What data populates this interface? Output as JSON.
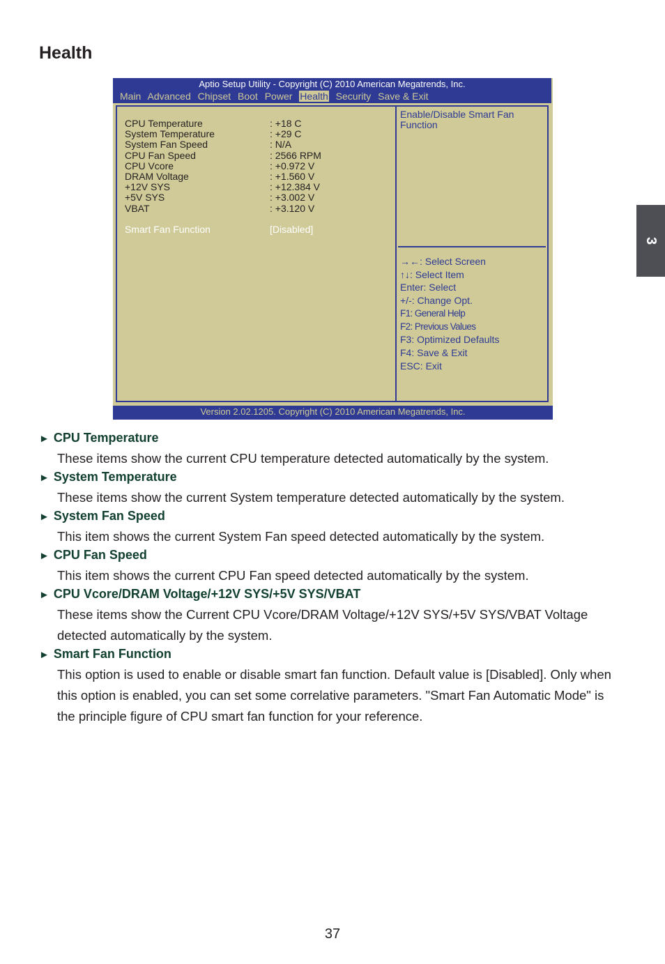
{
  "page": {
    "title": "Health",
    "chapter_tab": "3",
    "page_number": "37"
  },
  "bios": {
    "title": "Aptio Setup Utility - Copyright (C) 2010 American Megatrends, Inc.",
    "menu": [
      "Main",
      "Advanced",
      "Chipset",
      "Boot",
      "Power",
      "Health",
      "Security",
      "Save & Exit"
    ],
    "active_menu": "Health",
    "rows": [
      {
        "label": "CPU Temperature",
        "value": ": +18 C"
      },
      {
        "label": "System Temperature",
        "value": ": +29 C"
      },
      {
        "label": "System Fan Speed",
        "value": ": N/A"
      },
      {
        "label": "CPU Fan Speed",
        "value": ": 2566 RPM"
      },
      {
        "label": "CPU Vcore",
        "value": ": +0.972 V"
      },
      {
        "label": "DRAM Voltage",
        "value": ": +1.560 V"
      },
      {
        "label": "+12V SYS",
        "value": ": +12.384 V"
      },
      {
        "label": "+5V SYS",
        "value": ": +3.002 V"
      },
      {
        "label": "VBAT",
        "value": ": +3.120 V"
      }
    ],
    "selected_option": {
      "label": "Smart Fan Function",
      "value": "[Disabled]"
    },
    "help_text": "Enable/Disable Smart Fan Function",
    "keys": [
      "→←: Select Screen",
      "↑↓: Select Item",
      "Enter: Select",
      "+/-: Change Opt.",
      "F1:  General Help",
      "F2:  Previous Values",
      "F3: Optimized Defaults",
      "F4: Save & Exit",
      "ESC: Exit"
    ],
    "footer": "Version 2.02.1205. Copyright (C) 2010 American Megatrends, Inc.",
    "colors": {
      "bar": "#2e3a93",
      "panel": "#cfca98"
    }
  },
  "items": [
    {
      "heading": "CPU Temperature",
      "body": "These items show the current CPU temperature detected automatically by the system."
    },
    {
      "heading": "System Temperature",
      "body": "These items show the current System temperature detected automatically by the system."
    },
    {
      "heading": "System Fan Speed",
      "body": "This item shows the current System Fan speed detected automatically by the system."
    },
    {
      "heading": "CPU Fan Speed",
      "body": "This item shows the current CPU Fan speed detected automatically by the system."
    },
    {
      "heading": "CPU Vcore/DRAM Voltage/+12V SYS/+5V SYS/VBAT",
      "body": "These items show the Current CPU Vcore/DRAM Voltage/+12V SYS/+5V SYS/VBAT Voltage detected automatically by the system."
    },
    {
      "heading": "Smart Fan Function",
      "body": "This option is used to enable or disable smart fan function. Default value is [Disabled]. Only when this option is enabled, you can set some correlative parameters. \"Smart Fan Automatic Mode\" is the principle figure of CPU smart fan function for your reference."
    }
  ],
  "bullet_icon": "triangle-right"
}
